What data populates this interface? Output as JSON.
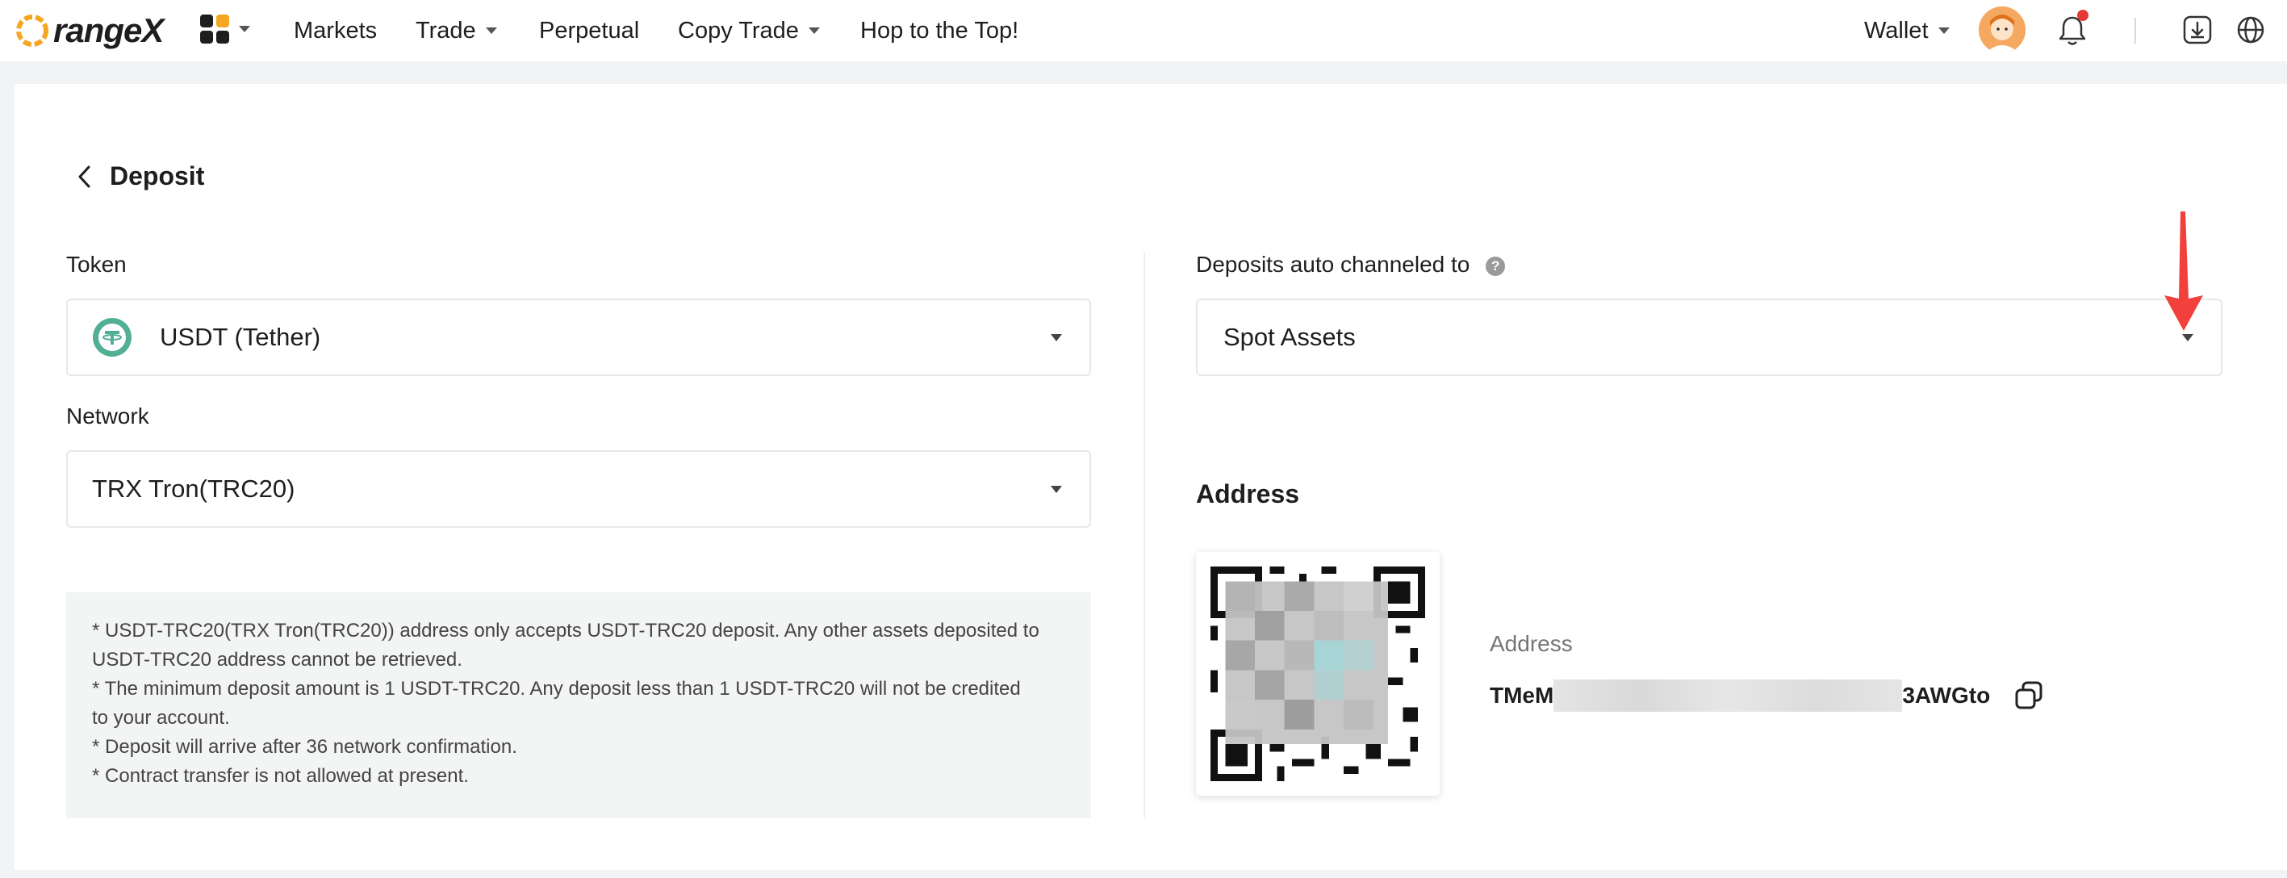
{
  "app": {
    "logo_text": "rangeX"
  },
  "nav": {
    "items": [
      {
        "label": "Markets",
        "has_caret": false
      },
      {
        "label": "Trade",
        "has_caret": true
      },
      {
        "label": "Perpetual",
        "has_caret": false
      },
      {
        "label": "Copy Trade",
        "has_caret": true
      },
      {
        "label": "Hop to the Top!",
        "has_caret": false
      }
    ],
    "wallet_label": "Wallet"
  },
  "deposit": {
    "title": "Deposit",
    "token_label": "Token",
    "token_value": "USDT (Tether)",
    "network_label": "Network",
    "network_value": "TRX Tron(TRC20)",
    "notice_lines": [
      "* USDT-TRC20(TRX Tron(TRC20)) address only accepts USDT-TRC20 deposit. Any other assets deposited to",
      "USDT-TRC20 address cannot be retrieved.",
      "* The minimum deposit amount is 1 USDT-TRC20. Any deposit less than 1 USDT-TRC20 will not be credited",
      "to your account.",
      "* Deposit will arrive after 36 network confirmation.",
      "* Contract transfer is not allowed at present."
    ],
    "channel_label": "Deposits auto channeled to",
    "channel_help": "?",
    "channel_value": "Spot Assets",
    "address_heading": "Address",
    "address_label": "Address",
    "address_start": "TMeM",
    "address_end": "3AWGto"
  },
  "colors": {
    "brand_orange": "#f5a623",
    "tether_teal": "#50af95",
    "annotation_red": "#f2403c",
    "notice_bg": "#f3f4f4"
  }
}
